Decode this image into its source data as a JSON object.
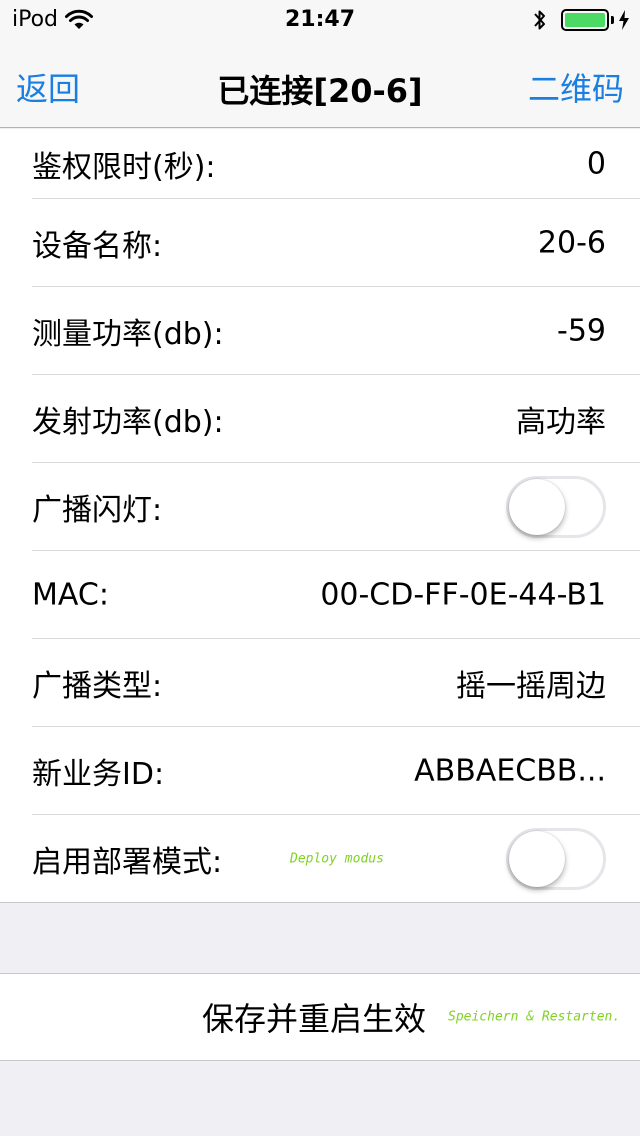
{
  "status_bar": {
    "carrier": "iPod",
    "time": "21:47",
    "battery_level": 1.0
  },
  "nav": {
    "back_label": "返回",
    "title": "已连接[20-6]",
    "right_label": "二维码"
  },
  "rows": [
    {
      "label": "鉴权限时(秒):",
      "value": "0"
    },
    {
      "label": "设备名称:",
      "value": "20-6"
    },
    {
      "label": "测量功率(db):",
      "value": "-59"
    },
    {
      "label": "发射功率(db):",
      "value": "高功率"
    },
    {
      "label": "广播闪灯:",
      "toggle": false
    },
    {
      "label": "MAC:",
      "value": "00-CD-FF-0E-44-B1"
    },
    {
      "label": "广播类型:",
      "value": "摇一摇周边"
    },
    {
      "label": "新业务ID:",
      "value": "ABBAECBB..."
    },
    {
      "label": "启用部署模式:",
      "toggle": false,
      "annotation": "Deploy modus"
    }
  ],
  "save": {
    "label": "保存并重启生效",
    "annotation": "Speichern & Restarten."
  },
  "colors": {
    "accent": "#1a7fe1",
    "annotation": "#7ed321",
    "battery": "#4cd964"
  }
}
